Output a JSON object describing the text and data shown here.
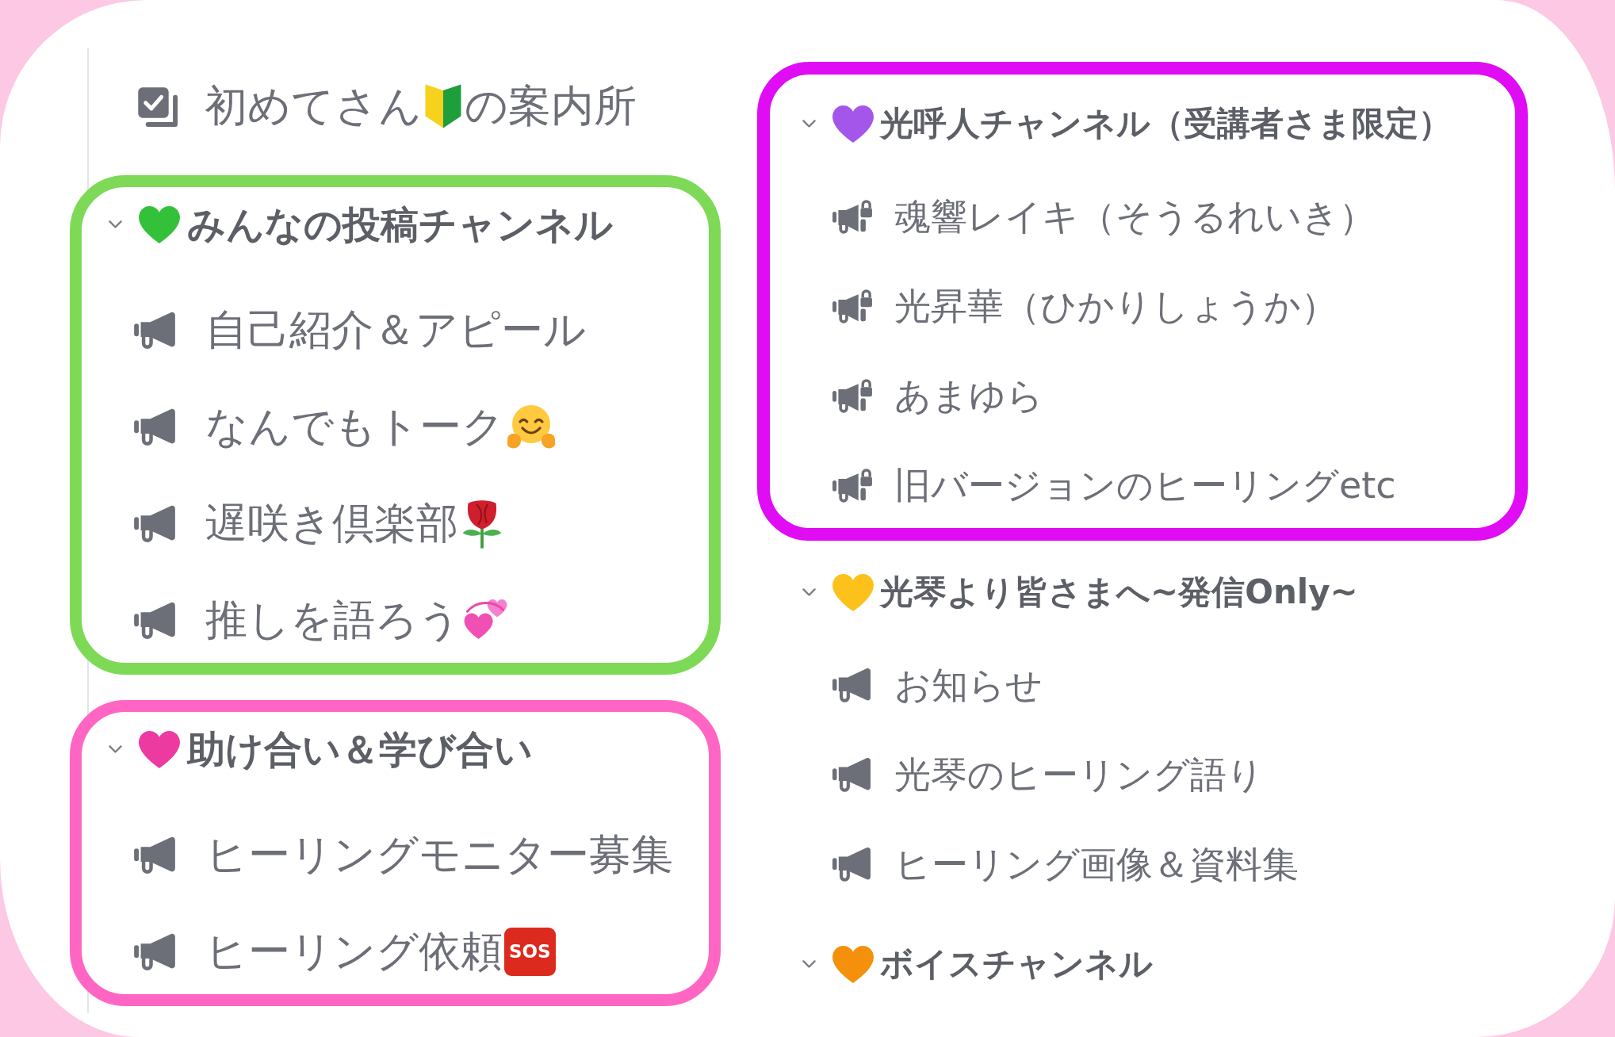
{
  "columns": [
    {
      "channels": [
        {
          "kind": "rules",
          "name": "初めてさん",
          "emoji": {
            "kind": "beginner"
          },
          "name_after": "の案内所"
        }
      ],
      "categories": [
        {
          "name": "みんなの投稿チャンネル",
          "color": "#34c13a",
          "frame": {
            "color": "#7ed957"
          },
          "expanded": true,
          "channels": [
            {
              "kind": "announcement",
              "locked": false,
              "name": "自己紹介＆アピール"
            },
            {
              "kind": "announcement",
              "locked": false,
              "name": "なんでもトーク",
              "emoji": {
                "kind": "hug"
              }
            },
            {
              "kind": "announcement",
              "locked": false,
              "name": "遅咲き倶楽部",
              "emoji": {
                "kind": "rose"
              }
            },
            {
              "kind": "announcement",
              "locked": false,
              "name": "推しを語ろう",
              "emoji": {
                "kind": "hearts"
              }
            }
          ]
        },
        {
          "name": "助け合い＆学び合い",
          "color": "#ec3aa0",
          "frame": {
            "color": "#ff66c4"
          },
          "expanded": true,
          "channels": [
            {
              "kind": "announcement",
              "locked": false,
              "name": "ヒーリングモニター募集"
            },
            {
              "kind": "announcement",
              "locked": false,
              "name": "ヒーリング依頼",
              "badge": "SOS"
            }
          ]
        }
      ]
    },
    {
      "categories": [
        {
          "name": "光呼人チャンネル（受講者さま限定）",
          "color": "#a455ea",
          "frame": {
            "color": "#e00cf4"
          },
          "expanded": true,
          "channels": [
            {
              "kind": "announcement",
              "locked": true,
              "name": "魂響レイキ（そうるれいき）"
            },
            {
              "kind": "announcement",
              "locked": true,
              "name": "光昇華（ひかりしょうか）"
            },
            {
              "kind": "announcement",
              "locked": true,
              "name": "あまゆら"
            },
            {
              "kind": "announcement",
              "locked": true,
              "name": "旧バージョンのヒーリングetc"
            }
          ]
        },
        {
          "name": "光琴より皆さまへ~発信Only~",
          "color": "#fcc21b",
          "expanded": true,
          "channels": [
            {
              "kind": "announcement",
              "locked": false,
              "name": "お知らせ"
            },
            {
              "kind": "announcement",
              "locked": false,
              "name": "光琴のヒーリング語り"
            },
            {
              "kind": "announcement",
              "locked": false,
              "name": "ヒーリング画像＆資料集"
            }
          ]
        },
        {
          "name": "ボイスチャンネル",
          "color": "#f4900c",
          "expanded": true
        }
      ]
    }
  ]
}
